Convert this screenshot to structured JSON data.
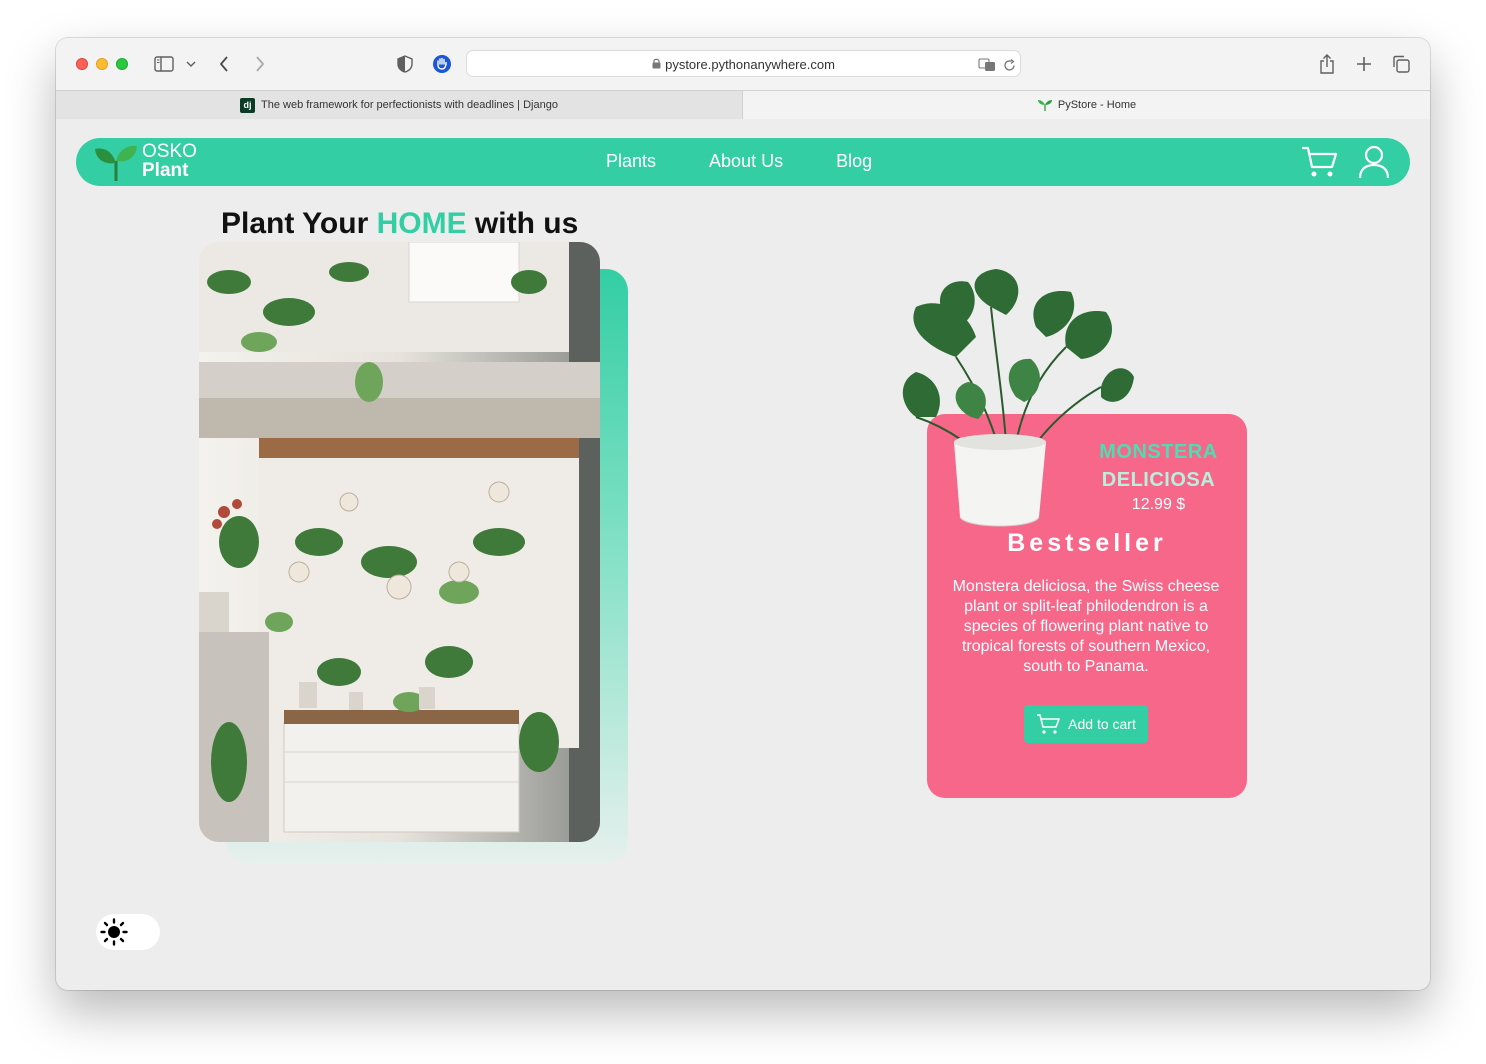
{
  "browser": {
    "url": "pystore.pythonanywhere.com",
    "tabs": [
      {
        "label": "The web framework for perfectionists with deadlines | Django",
        "active": false,
        "favicon": "django-icon"
      },
      {
        "label": "PyStore - Home",
        "active": true,
        "favicon": "leaf-icon"
      }
    ],
    "favicon_text": "dj"
  },
  "nav": {
    "logo_line1": "OSKO",
    "logo_line2": "Plant",
    "links": [
      "Plants",
      "About Us",
      "Blog"
    ],
    "icons": [
      "cart-icon",
      "user-icon"
    ]
  },
  "hero": {
    "title_prefix": "Plant Your ",
    "title_accent": "HOME",
    "title_suffix": " with us"
  },
  "product": {
    "name_line1": "MONSTERA",
    "name_line2": "DELICIOSA",
    "price": "12.99 $",
    "tag": "Bestseller",
    "description": "Monstera deliciosa, the Swiss cheese plant or split-leaf philodendron is a species of flowering plant native to tropical forests of southern Mexico, south to Panama.",
    "button_label": "Add to cart"
  },
  "theme_toggle": {
    "icon": "sun-icon",
    "mode": "light"
  },
  "colors": {
    "accent": "#33cea4",
    "card": "#f7678a",
    "page_bg": "#ededed"
  }
}
